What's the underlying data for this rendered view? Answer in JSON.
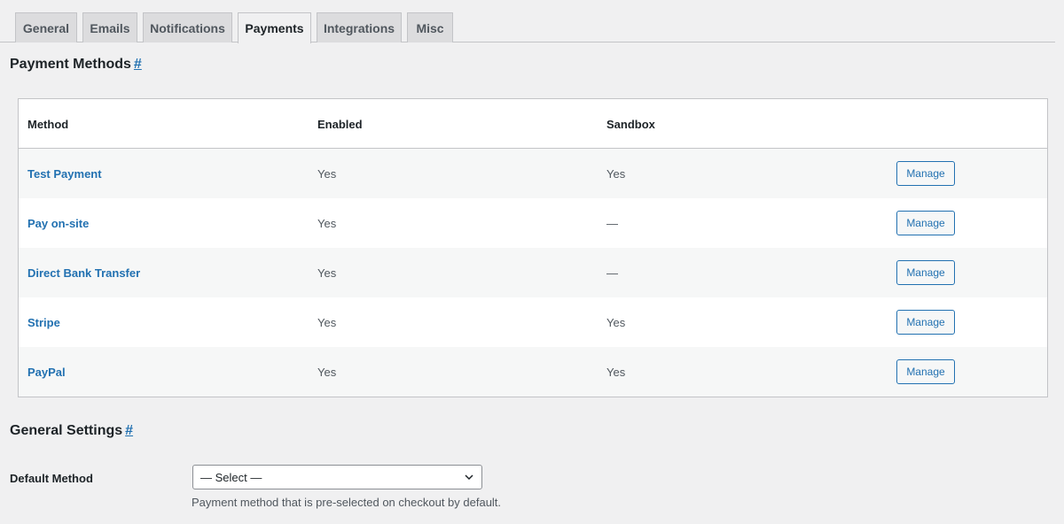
{
  "tabs": [
    {
      "label": "General"
    },
    {
      "label": "Emails"
    },
    {
      "label": "Notifications"
    },
    {
      "label": "Payments",
      "active": true
    },
    {
      "label": "Integrations"
    },
    {
      "label": "Misc"
    }
  ],
  "payment_methods": {
    "title": "Payment Methods",
    "anchor": "#",
    "columns": {
      "method": "Method",
      "enabled": "Enabled",
      "sandbox": "Sandbox"
    },
    "rows": [
      {
        "method": "Test Payment",
        "enabled": "Yes",
        "sandbox": "Yes",
        "action": "Manage"
      },
      {
        "method": "Pay on-site",
        "enabled": "Yes",
        "sandbox": "—",
        "action": "Manage"
      },
      {
        "method": "Direct Bank Transfer",
        "enabled": "Yes",
        "sandbox": "—",
        "action": "Manage"
      },
      {
        "method": "Stripe",
        "enabled": "Yes",
        "sandbox": "Yes",
        "action": "Manage"
      },
      {
        "method": "PayPal",
        "enabled": "Yes",
        "sandbox": "Yes",
        "action": "Manage"
      }
    ]
  },
  "general_settings": {
    "title": "General Settings",
    "anchor": "#",
    "default_method": {
      "label": "Default Method",
      "value": "— Select —",
      "description": "Payment method that is pre-selected on checkout by default."
    }
  },
  "colors": {
    "accent": "#2271b1",
    "background": "#f0f0f1",
    "tab_inactive": "#dcdcde"
  }
}
